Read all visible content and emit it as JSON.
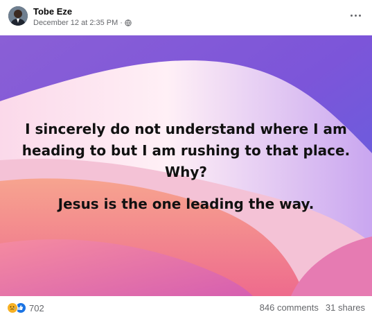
{
  "post": {
    "author": "Tobe Eze",
    "timestamp": "December 12 at 2:35 PM",
    "privacy_icon": "globe-icon",
    "menu_icon": "more-options-icon",
    "text_lines": [
      "I sincerely do not understand where I am",
      "heading to but I am rushing to that place.",
      "Why?"
    ],
    "text_answer": "Jesus is the one leading the way.",
    "background_colors": [
      "#7b4fd0",
      "#e86ea8",
      "#f6a28f",
      "#ffe6f0"
    ]
  },
  "footer": {
    "reaction_icons": [
      "sad-reaction-icon",
      "like-reaction-icon"
    ],
    "reaction_count": "702",
    "comments": "846 comments",
    "shares": "31 shares"
  }
}
